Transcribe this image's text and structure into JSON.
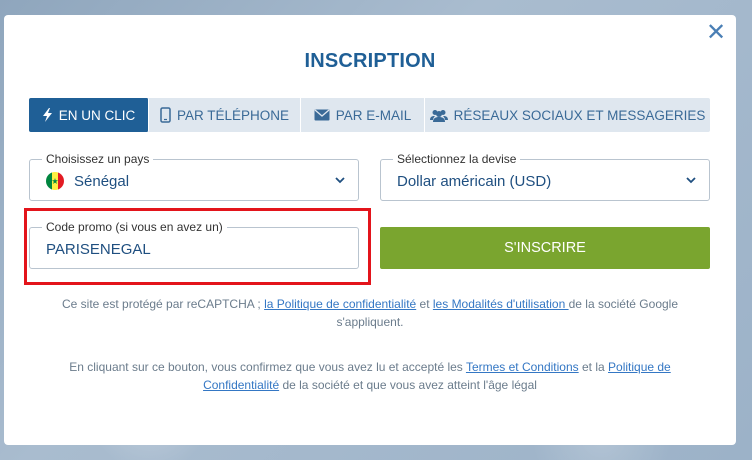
{
  "modal": {
    "title": "INSCRIPTION",
    "close_label": "✕"
  },
  "tabs": [
    {
      "label": "EN UN CLIC",
      "icon": "lightning-icon",
      "active": true
    },
    {
      "label": "PAR TÉLÉPHONE",
      "icon": "phone-icon",
      "active": false
    },
    {
      "label": "PAR E-MAIL",
      "icon": "envelope-icon",
      "active": false
    },
    {
      "label": "RÉSEAUX SOCIAUX ET MESSAGERIES",
      "icon": "users-icon",
      "active": false
    }
  ],
  "country": {
    "legend": "Choisissez un pays",
    "value": "Sénégal",
    "flag_colors": [
      "#00853f",
      "#fdef42",
      "#e31b23"
    ]
  },
  "currency": {
    "legend": "Sélectionnez la devise",
    "value": "Dollar américain (USD)"
  },
  "promo": {
    "legend": "Code promo (si vous en avez un)",
    "value": "PARISENEGAL",
    "highlight_color": "#e3141b"
  },
  "register_button": {
    "label": "S'INSCRIRE",
    "color": "#7aa52f"
  },
  "recaptcha": {
    "text_before": "Ce site est protégé par reCAPTCHA ; ",
    "privacy_link": "la Politique de confidentialité",
    "text_middle": " et ",
    "terms_link": "les Modalités d'utilisation ",
    "text_after": "de la société Google s'appliquent."
  },
  "consent": {
    "text_before": "En cliquant sur ce bouton, vous confirmez que vous avez lu et accepté les ",
    "terms_link": "Termes et Conditions",
    "text_middle": " et la ",
    "privacy_link": "Politique de Confidentialité",
    "text_after": " de la société et que vous avez atteint l'âge légal"
  },
  "colors": {
    "primary": "#1f5f96",
    "link": "#3477c4"
  }
}
